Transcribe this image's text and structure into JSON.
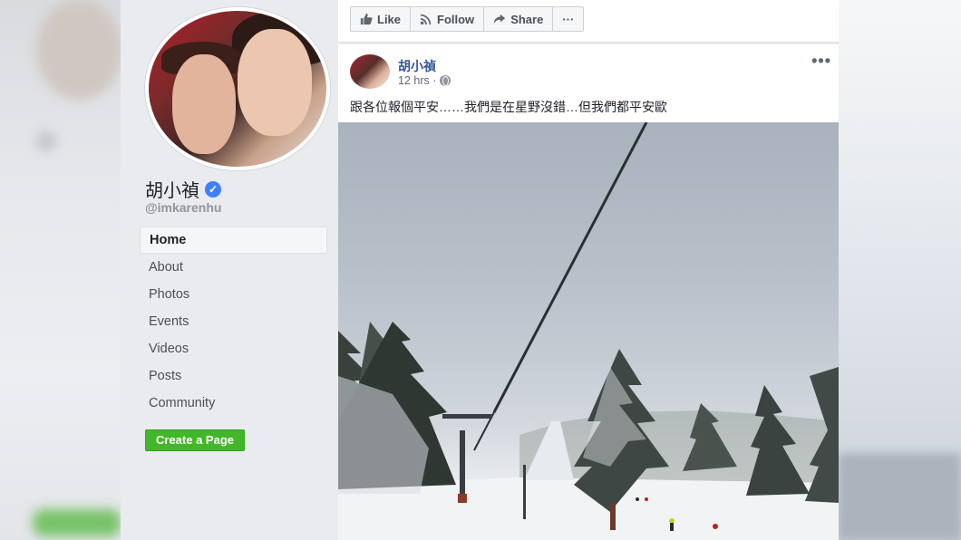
{
  "sidebar": {
    "page_name": "胡小禎",
    "verified_icon": "verified-badge-icon",
    "handle": "@imkarenhu",
    "nav": [
      {
        "label": "Home",
        "active": true
      },
      {
        "label": "About",
        "active": false
      },
      {
        "label": "Photos",
        "active": false
      },
      {
        "label": "Events",
        "active": false
      },
      {
        "label": "Videos",
        "active": false
      },
      {
        "label": "Posts",
        "active": false
      },
      {
        "label": "Community",
        "active": false
      }
    ],
    "create_page_label": "Create a Page"
  },
  "action_bar": {
    "like_label": "Like",
    "follow_label": "Follow",
    "share_label": "Share",
    "more_label": "···"
  },
  "post": {
    "author": "胡小禎",
    "time": "12 hrs ·",
    "menu": "•••",
    "text": "跟各位報個平安……我們是在星野沒錯…但我們都平安歐"
  },
  "colors": {
    "link_blue": "#365899",
    "create_green": "#42b72a",
    "verified_blue": "#4080ff"
  }
}
